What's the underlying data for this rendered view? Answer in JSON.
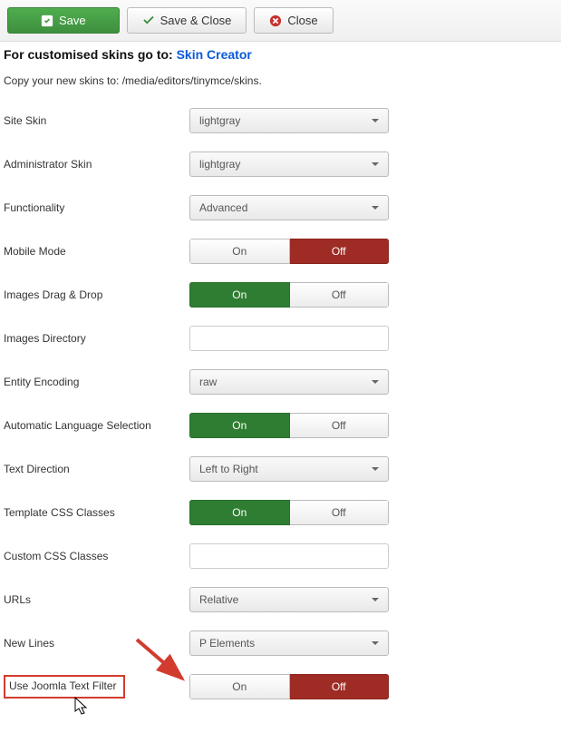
{
  "toolbar": {
    "save": "Save",
    "save_close": "Save & Close",
    "close": "Close"
  },
  "heading": {
    "prefix": "For customised skins go to:",
    "link": "Skin Creator"
  },
  "copy_line": "Copy your new skins to: /media/editors/tinymce/skins.",
  "labels": {
    "site_skin": "Site Skin",
    "admin_skin": "Administrator Skin",
    "functionality": "Functionality",
    "mobile_mode": "Mobile Mode",
    "images_dragdrop": "Images Drag & Drop",
    "images_directory": "Images Directory",
    "entity_encoding": "Entity Encoding",
    "auto_lang": "Automatic Language Selection",
    "text_direction": "Text Direction",
    "template_css": "Template CSS Classes",
    "custom_css": "Custom CSS Classes",
    "urls": "URLs",
    "new_lines": "New Lines",
    "joomla_filter": "Use Joomla Text Filter"
  },
  "values": {
    "site_skin": "lightgray",
    "admin_skin": "lightgray",
    "functionality": "Advanced",
    "entity_encoding": "raw",
    "text_direction": "Left to Right",
    "urls": "Relative",
    "new_lines": "P Elements",
    "images_directory": "",
    "custom_css": ""
  },
  "toggle": {
    "on": "On",
    "off": "Off"
  },
  "toggles_state": {
    "mobile_mode": "off",
    "images_dragdrop": "on",
    "auto_lang": "on",
    "template_css": "on",
    "joomla_filter": "off"
  }
}
